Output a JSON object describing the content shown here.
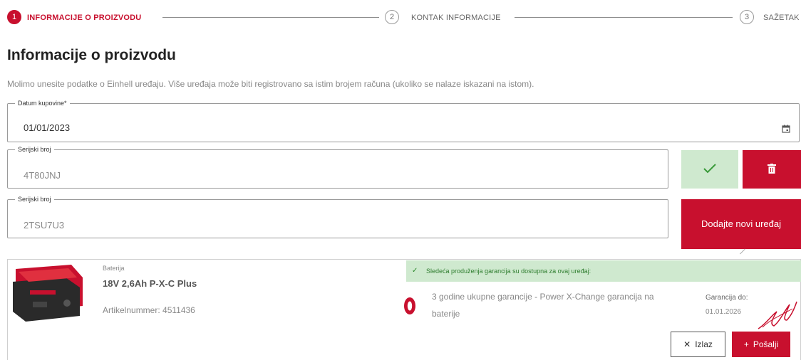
{
  "stepper": {
    "steps": [
      {
        "number": "1",
        "label": "INFORMACIJE O PROIZVODU",
        "active": true
      },
      {
        "number": "2",
        "label": "KONTAK INFORMACIJE",
        "active": false
      },
      {
        "number": "3",
        "label": "SAŽETAK",
        "active": false
      }
    ]
  },
  "page": {
    "title": "Informacije o proizvodu",
    "subtitle": "Molimo unesite podatke o Einhell uređaju. Više uređaja može biti registrovano sa istim brojem računa (ukoliko se nalaze iskazani na istom)."
  },
  "form": {
    "date": {
      "label": "Datum kupovine*",
      "value": "01/01/2023",
      "icon": "calendar-icon"
    },
    "serials": [
      {
        "label": "Serijski broj",
        "value": "4T80JNJ"
      },
      {
        "label": "Serijski broj",
        "value": "2TSU7U3"
      }
    ],
    "add_device_label": "Dodajte novi uređaj",
    "confirm_icon": "checkmark-icon",
    "delete_icon": "trash-icon"
  },
  "product": {
    "category": "Baterija",
    "name": "18V 2,6Ah P-X-C Plus",
    "article": "Artikelnummer: 4511436"
  },
  "warranty": {
    "notice": "Sledeća produženja garancija su dostupna za ovaj uređaj:",
    "offer": "3 godine ukupne garancije - Power X-Change garancija na baterije",
    "valid_label": "Garancija do:",
    "valid_date": "01.01.2026",
    "exit_label": "Izlaz",
    "send_label": "Pošalji"
  },
  "colors": {
    "accent": "#c8102e",
    "success_bg": "#cfe9cf",
    "success_text": "#2e7d2e"
  }
}
